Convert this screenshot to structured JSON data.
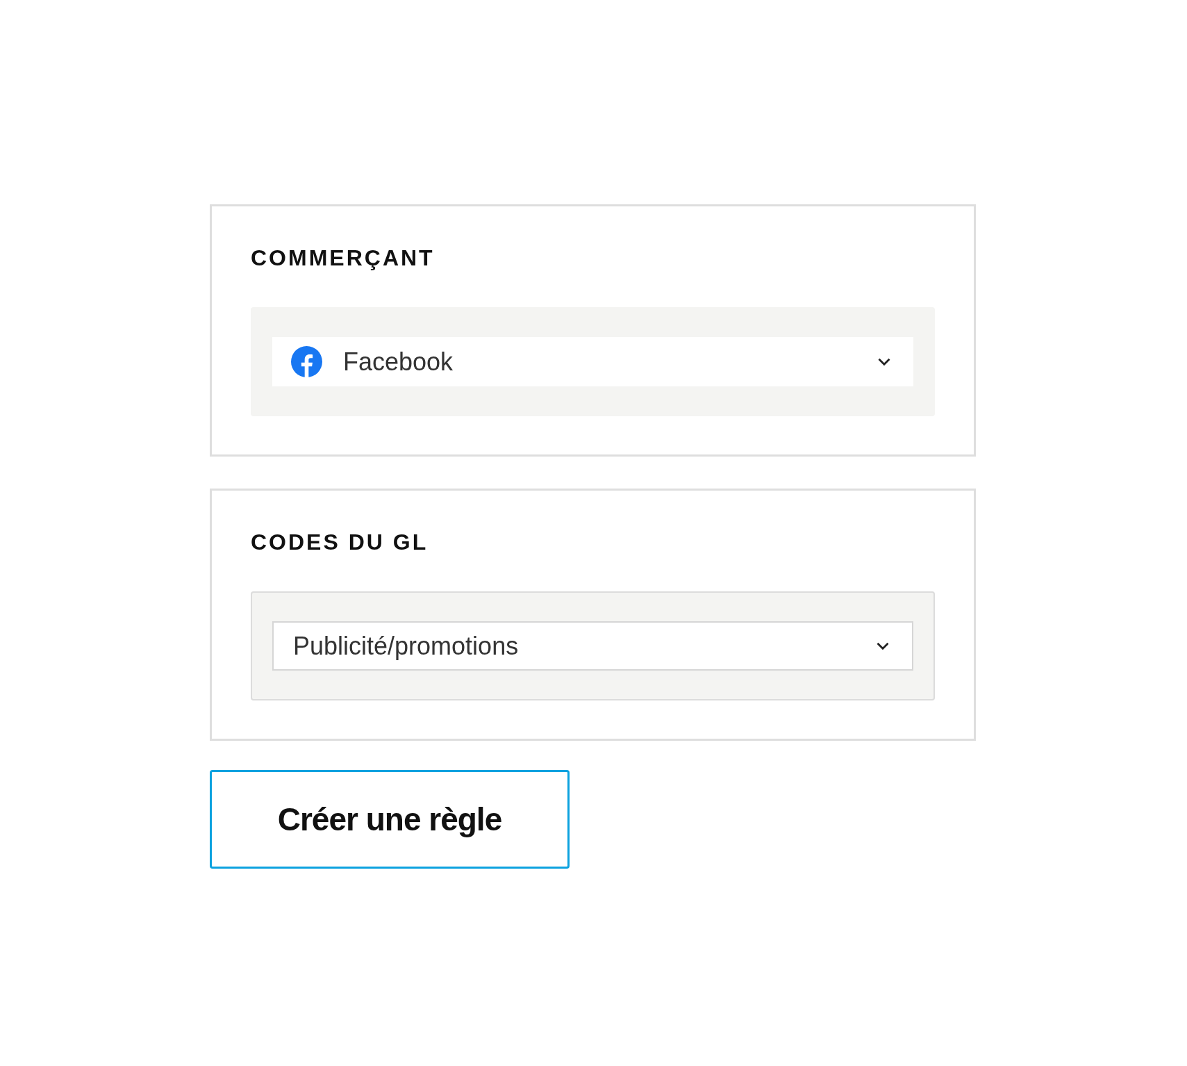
{
  "sections": [
    {
      "heading": "COMMERÇANT",
      "dropdown": {
        "kind": "brand",
        "value": "Facebook"
      }
    },
    {
      "heading": "CODES DU GL",
      "dropdown": {
        "kind": "plain",
        "value": "Publicité/promotions"
      }
    }
  ],
  "button": {
    "label": "Créer une règle"
  }
}
